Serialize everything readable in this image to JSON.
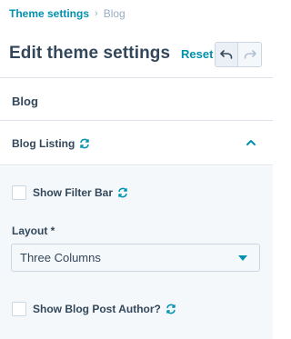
{
  "breadcrumb": {
    "parent": "Theme settings",
    "separator": "›",
    "current": "Blog"
  },
  "header": {
    "title": "Edit theme settings",
    "reset_label": "Reset"
  },
  "section": {
    "title": "Blog"
  },
  "group": {
    "title": "Blog Listing",
    "expanded": true
  },
  "fields": {
    "show_filter_bar": {
      "label": "Show Filter Bar",
      "checked": false
    },
    "layout": {
      "label": "Layout *",
      "value": "Three Columns"
    },
    "show_author": {
      "label": "Show Blog Post Author?",
      "checked": false
    }
  },
  "colors": {
    "accent": "#0091ae",
    "text": "#33475b",
    "panel_bg": "#f5f8fa",
    "border": "#dfe3eb"
  },
  "icons": [
    "undo-icon",
    "redo-icon",
    "sync-icon",
    "chevron-up-icon",
    "caret-down-icon"
  ]
}
